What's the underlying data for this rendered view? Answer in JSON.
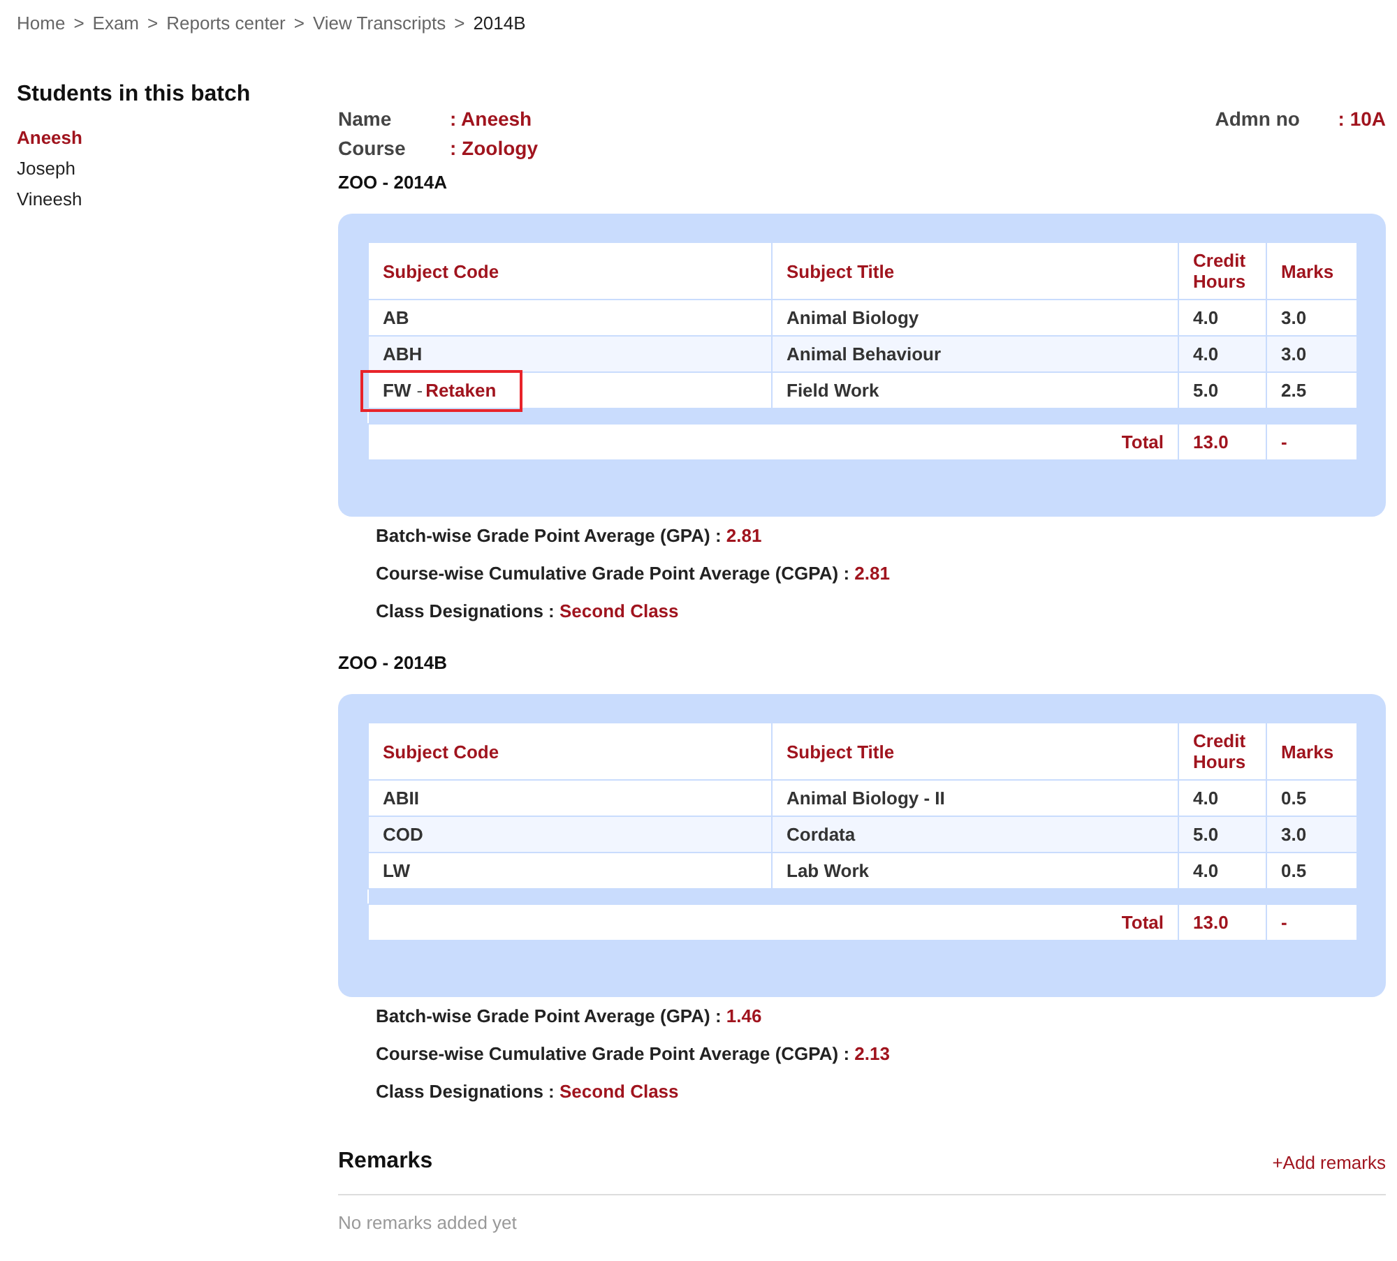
{
  "breadcrumb": [
    {
      "label": "Home",
      "current": false
    },
    {
      "label": "Exam",
      "current": false
    },
    {
      "label": "Reports center",
      "current": false
    },
    {
      "label": "View Transcripts",
      "current": false
    },
    {
      "label": "2014B",
      "current": true
    }
  ],
  "breadcrumb_separator": ">",
  "sidebar": {
    "title": "Students in this batch",
    "students": [
      {
        "name": "Aneesh",
        "selected": true
      },
      {
        "name": "Joseph",
        "selected": false
      },
      {
        "name": "Vineesh",
        "selected": false
      }
    ]
  },
  "student": {
    "name_label": "Name",
    "name": ": Aneesh",
    "course_label": "Course",
    "course": ": Zoology",
    "admn_label": "Admn no",
    "admn": ": 10A"
  },
  "batches": [
    {
      "title": "ZOO - 2014A",
      "columns": [
        "Subject Code",
        "Subject Title",
        "Credit Hours",
        "Marks"
      ],
      "rows": [
        {
          "code": "AB",
          "title": "Animal Biology",
          "credit": "4.0",
          "marks": "3.0",
          "highlighted": false
        },
        {
          "code": "ABH",
          "title": "Animal Behaviour",
          "credit": "4.0",
          "marks": "3.0",
          "highlighted": false
        },
        {
          "code": "FW",
          "separator": "-",
          "note": "Retaken",
          "title": "Field Work",
          "credit": "5.0",
          "marks": "2.5",
          "highlighted": true
        }
      ],
      "total_label": "Total",
      "total_credit": "13.0",
      "total_marks": "-",
      "stats": [
        {
          "label": "Batch-wise Grade Point Average (GPA) :",
          "value": "2.81"
        },
        {
          "label": "Course-wise Cumulative Grade Point Average (CGPA) :",
          "value": "2.81"
        },
        {
          "label": "Class Designations :",
          "value": "Second Class"
        }
      ]
    },
    {
      "title": "ZOO - 2014B",
      "columns": [
        "Subject Code",
        "Subject Title",
        "Credit Hours",
        "Marks"
      ],
      "rows": [
        {
          "code": "ABII",
          "title": "Animal Biology - II",
          "credit": "4.0",
          "marks": "0.5",
          "highlighted": false
        },
        {
          "code": "COD",
          "title": "Cordata",
          "credit": "5.0",
          "marks": "3.0",
          "highlighted": false
        },
        {
          "code": "LW",
          "title": "Lab Work",
          "credit": "4.0",
          "marks": "0.5",
          "highlighted": false
        }
      ],
      "total_label": "Total",
      "total_credit": "13.0",
      "total_marks": "-",
      "stats": [
        {
          "label": "Batch-wise Grade Point Average (GPA) :",
          "value": "1.46"
        },
        {
          "label": "Course-wise Cumulative Grade Point Average (CGPA) :",
          "value": "2.13"
        },
        {
          "label": "Class Designations :",
          "value": "Second Class"
        }
      ]
    }
  ],
  "remarks": {
    "title": "Remarks",
    "add_link": "+Add remarks",
    "empty": "No remarks added yet"
  }
}
